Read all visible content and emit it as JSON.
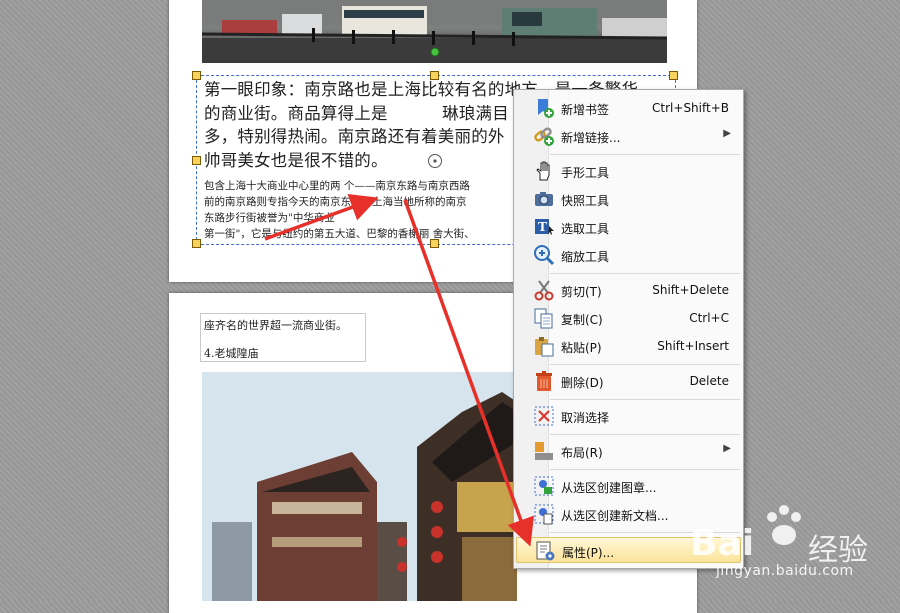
{
  "document": {
    "top_text": {
      "large_lines": [
        "第一眼印象：南京路也是上海比较有名的地方，是一条繁华",
        "的商业街。商品算得上是          琳琅满目",
        "多，特别得热闹。南京路还有着美丽的外",
        "帅哥美女也是很不错的。"
      ],
      "small_lines": [
        "包含上海十大商业中心里的两 个——南京东路与南京西路",
        "前的南京路则专指今天的南京东路。上海当地所称的南京",
        "东路步行街被誉为\"中华商业",
        "第一街\"，它是与纽约的第五大道、巴黎的香榭丽 舍大街、"
      ]
    },
    "page2": {
      "line1": "座齐名的世界超一流商业街。",
      "line2": "4.老城隍庙"
    }
  },
  "context_menu": {
    "items": [
      {
        "label": "新增书签",
        "shortcut": "Ctrl+Shift+B",
        "icon": "bookmark-add-icon"
      },
      {
        "label": "新增链接...",
        "shortcut": "",
        "submenu": true,
        "icon": "link-add-icon"
      },
      {
        "label": "手形工具",
        "shortcut": "",
        "icon": "hand-tool-icon"
      },
      {
        "label": "快照工具",
        "shortcut": "",
        "icon": "camera-icon"
      },
      {
        "label": "选取工具",
        "shortcut": "",
        "icon": "text-select-icon"
      },
      {
        "label": "缩放工具",
        "shortcut": "",
        "icon": "zoom-icon"
      },
      {
        "label": "剪切(T)",
        "shortcut": "Shift+Delete",
        "icon": "scissors-icon"
      },
      {
        "label": "复制(C)",
        "shortcut": "Ctrl+C",
        "icon": "copy-icon"
      },
      {
        "label": "粘贴(P)",
        "shortcut": "Shift+Insert",
        "icon": "paste-icon"
      },
      {
        "label": "删除(D)",
        "shortcut": "Delete",
        "icon": "trash-icon"
      },
      {
        "label": "取消选择",
        "shortcut": "",
        "icon": "deselect-icon"
      },
      {
        "label": "布局(R)",
        "shortcut": "",
        "submenu": true,
        "icon": "layout-icon"
      },
      {
        "label": "从选区创建图章...",
        "shortcut": "",
        "icon": "stamp-icon"
      },
      {
        "label": "从选区创建新文档...",
        "shortcut": "",
        "icon": "new-document-icon"
      },
      {
        "label": "属性(P)...",
        "shortcut": "",
        "highlighted": true,
        "icon": "properties-icon"
      }
    ]
  },
  "watermark": {
    "brand": "Bai",
    "brand_suffix": "经验",
    "url": "jingyan.baidu.com"
  },
  "colors": {
    "arrow": "#e8302a",
    "selection": "#3e6fd6",
    "handle": "#f8d25a",
    "highlight": "#fbe39a"
  }
}
